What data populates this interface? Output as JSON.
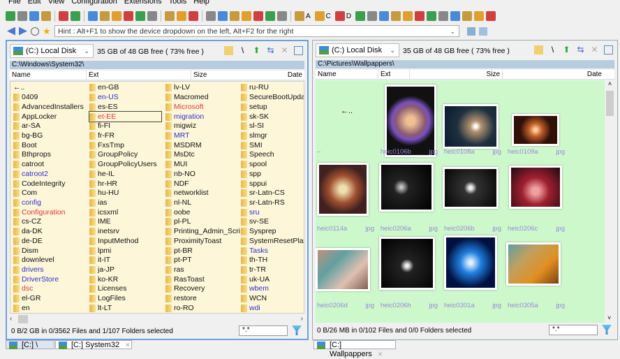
{
  "menu": [
    "File",
    "Edit",
    "View",
    "Configuration",
    "Extensions",
    "Tools",
    "Help"
  ],
  "toolbar": {
    "icons": [
      "refresh",
      "cut",
      "copy",
      "paste",
      "sep",
      "columns",
      "dropdown",
      "sep",
      "new-file",
      "move",
      "delete",
      "archive",
      "package",
      "new-folder",
      "sep",
      "find",
      "edit",
      "compare",
      "sep",
      "folder-size",
      "copy-path",
      "copy-name",
      "properties",
      "clipboard",
      "rename",
      "color",
      "sep",
      "drive-a",
      "drive-c",
      "drive-d",
      "desktop",
      "folder1",
      "folder2",
      "folder3",
      "folder4",
      "folder5",
      "folder6",
      "network",
      "favorite",
      "settings",
      "ftp",
      "phone"
    ],
    "drive_labels": {
      "drive-a": "A",
      "drive-c": "C",
      "drive-d": "D"
    },
    "colors": [
      "#3aa050",
      "#888",
      "#4a8ad8",
      "#c89a40",
      "#e0a030",
      "#d04040"
    ]
  },
  "address": {
    "hint": "Hint : Alt+F1 to show the device dropdown on the left, Alt+F2 for the right"
  },
  "left": {
    "drive": "(C:) Local Disk",
    "free": "35 GB of 48 GB free ( 73% free )",
    "path": "C:\\Windows\\System32\\",
    "headers": [
      "Name",
      "Ext",
      "Size",
      "Date"
    ],
    "columns": [
      [
        [
          "←..",
          "k"
        ],
        [
          "0409",
          "k"
        ],
        [
          "AdvancedInstallers",
          "k"
        ],
        [
          "AppLocker",
          "k"
        ],
        [
          "ar-SA",
          "k"
        ],
        [
          "bg-BG",
          "k"
        ],
        [
          "Boot",
          "k"
        ],
        [
          "Bthprops",
          "k"
        ],
        [
          "catroot",
          "k"
        ],
        [
          "catroot2",
          "b"
        ],
        [
          "CodeIntegrity",
          "k"
        ],
        [
          "Com",
          "k"
        ],
        [
          "config",
          "b"
        ],
        [
          "Configuration",
          "r"
        ],
        [
          "cs-CZ",
          "k"
        ],
        [
          "da-DK",
          "k"
        ],
        [
          "de-DE",
          "k"
        ],
        [
          "Dism",
          "k"
        ],
        [
          "downlevel",
          "k"
        ],
        [
          "drivers",
          "b"
        ],
        [
          "DriverStore",
          "b"
        ],
        [
          "dsc",
          "r"
        ],
        [
          "el-GR",
          "k"
        ],
        [
          "en",
          "k"
        ]
      ],
      [
        [
          "en-GB",
          "k"
        ],
        [
          "en-US",
          "b"
        ],
        [
          "es-ES",
          "k"
        ],
        [
          "et-EE",
          "r"
        ],
        [
          "fi-FI",
          "k"
        ],
        [
          "fr-FR",
          "k"
        ],
        [
          "FxsTmp",
          "k"
        ],
        [
          "GroupPolicy",
          "k"
        ],
        [
          "GroupPolicyUsers",
          "k"
        ],
        [
          "he-IL",
          "k"
        ],
        [
          "hr-HR",
          "k"
        ],
        [
          "hu-HU",
          "k"
        ],
        [
          "ias",
          "k"
        ],
        [
          "icsxml",
          "k"
        ],
        [
          "IME",
          "k"
        ],
        [
          "inetsrv",
          "k"
        ],
        [
          "InputMethod",
          "k"
        ],
        [
          "lpmi",
          "k"
        ],
        [
          "it-IT",
          "k"
        ],
        [
          "ja-JP",
          "k"
        ],
        [
          "ko-KR",
          "k"
        ],
        [
          "Licenses",
          "k"
        ],
        [
          "LogFiles",
          "k"
        ],
        [
          "lt-LT",
          "k"
        ]
      ],
      [
        [
          "lv-LV",
          "k"
        ],
        [
          "Macromed",
          "k"
        ],
        [
          "Microsoft",
          "r"
        ],
        [
          "migration",
          "b"
        ],
        [
          "migwiz",
          "k"
        ],
        [
          "MRT",
          "b"
        ],
        [
          "MSDRM",
          "k"
        ],
        [
          "MsDtc",
          "k"
        ],
        [
          "MUI",
          "k"
        ],
        [
          "nb-NO",
          "k"
        ],
        [
          "NDF",
          "k"
        ],
        [
          "networklist",
          "k"
        ],
        [
          "nl-NL",
          "k"
        ],
        [
          "oobe",
          "k"
        ],
        [
          "pl-PL",
          "k"
        ],
        [
          "Printing_Admin_Scri...",
          "k"
        ],
        [
          "ProximityToast",
          "k"
        ],
        [
          "pt-BR",
          "k"
        ],
        [
          "pt-PT",
          "k"
        ],
        [
          "ras",
          "k"
        ],
        [
          "RasToast",
          "k"
        ],
        [
          "Recovery",
          "k"
        ],
        [
          "restore",
          "k"
        ],
        [
          "ro-RO",
          "k"
        ]
      ],
      [
        [
          "ru-RU",
          "k"
        ],
        [
          "SecureBootUpdate",
          "k"
        ],
        [
          "setup",
          "k"
        ],
        [
          "sk-SK",
          "k"
        ],
        [
          "sl-SI",
          "k"
        ],
        [
          "slmgr",
          "k"
        ],
        [
          "SMI",
          "k"
        ],
        [
          "Speech",
          "k"
        ],
        [
          "spool",
          "k"
        ],
        [
          "spp",
          "k"
        ],
        [
          "sppui",
          "k"
        ],
        [
          "sr-Latn-CS",
          "k"
        ],
        [
          "sr-Latn-RS",
          "k"
        ],
        [
          "sru",
          "b"
        ],
        [
          "sv-SE",
          "k"
        ],
        [
          "Sysprep",
          "k"
        ],
        [
          "SystemResetPlatfor",
          "k"
        ],
        [
          "Tasks",
          "b"
        ],
        [
          "th-TH",
          "k"
        ],
        [
          "tr-TR",
          "k"
        ],
        [
          "uk-UA",
          "k"
        ],
        [
          "wbem",
          "b"
        ],
        [
          "WCN",
          "k"
        ],
        [
          "wdi",
          "b"
        ]
      ]
    ],
    "focused": "et-EE",
    "status": "0 B/2 GB in 0/3562 Files and 1/107 Folders selected",
    "filter": "*.*"
  },
  "right": {
    "drive": "(C:) Local Disk",
    "free": "35 GB of 48 GB free ( 73% free )",
    "path": "C:\\Pictures\\Wallpappers\\",
    "headers": [
      "Name",
      "Ext",
      "Size",
      "Date"
    ],
    "parent": "..",
    "files": [
      [
        "heic0106b",
        "jpg"
      ],
      [
        "heic0108a",
        "jpg"
      ],
      [
        "heic0109a",
        "jpg"
      ],
      [
        "heic0114a",
        "jpg"
      ],
      [
        "heic0206a",
        "jpg"
      ],
      [
        "heic0206b",
        "jpg"
      ],
      [
        "heic0206c",
        "jpg"
      ],
      [
        "heic0206d",
        "jpg"
      ],
      [
        "heic0206h",
        "jpg"
      ],
      [
        "heic0301a",
        "jpg"
      ],
      [
        "heic0305a",
        "jpg"
      ]
    ],
    "status": "0 B/26 MB in 0/102 Files and 0/0 Folders selected",
    "filter": "*.*"
  },
  "tabs": {
    "left": [
      "[C:] \\",
      "[C:] System32"
    ],
    "right": [
      "[C:] Wallpappers"
    ]
  },
  "colors": {
    "k": "#111111",
    "b": "#3030d0",
    "r": "#e03a3a",
    "accent": "#6fa0d8",
    "grid_bg": "#ccf8cc",
    "list_bg": "#fdf6d8"
  }
}
